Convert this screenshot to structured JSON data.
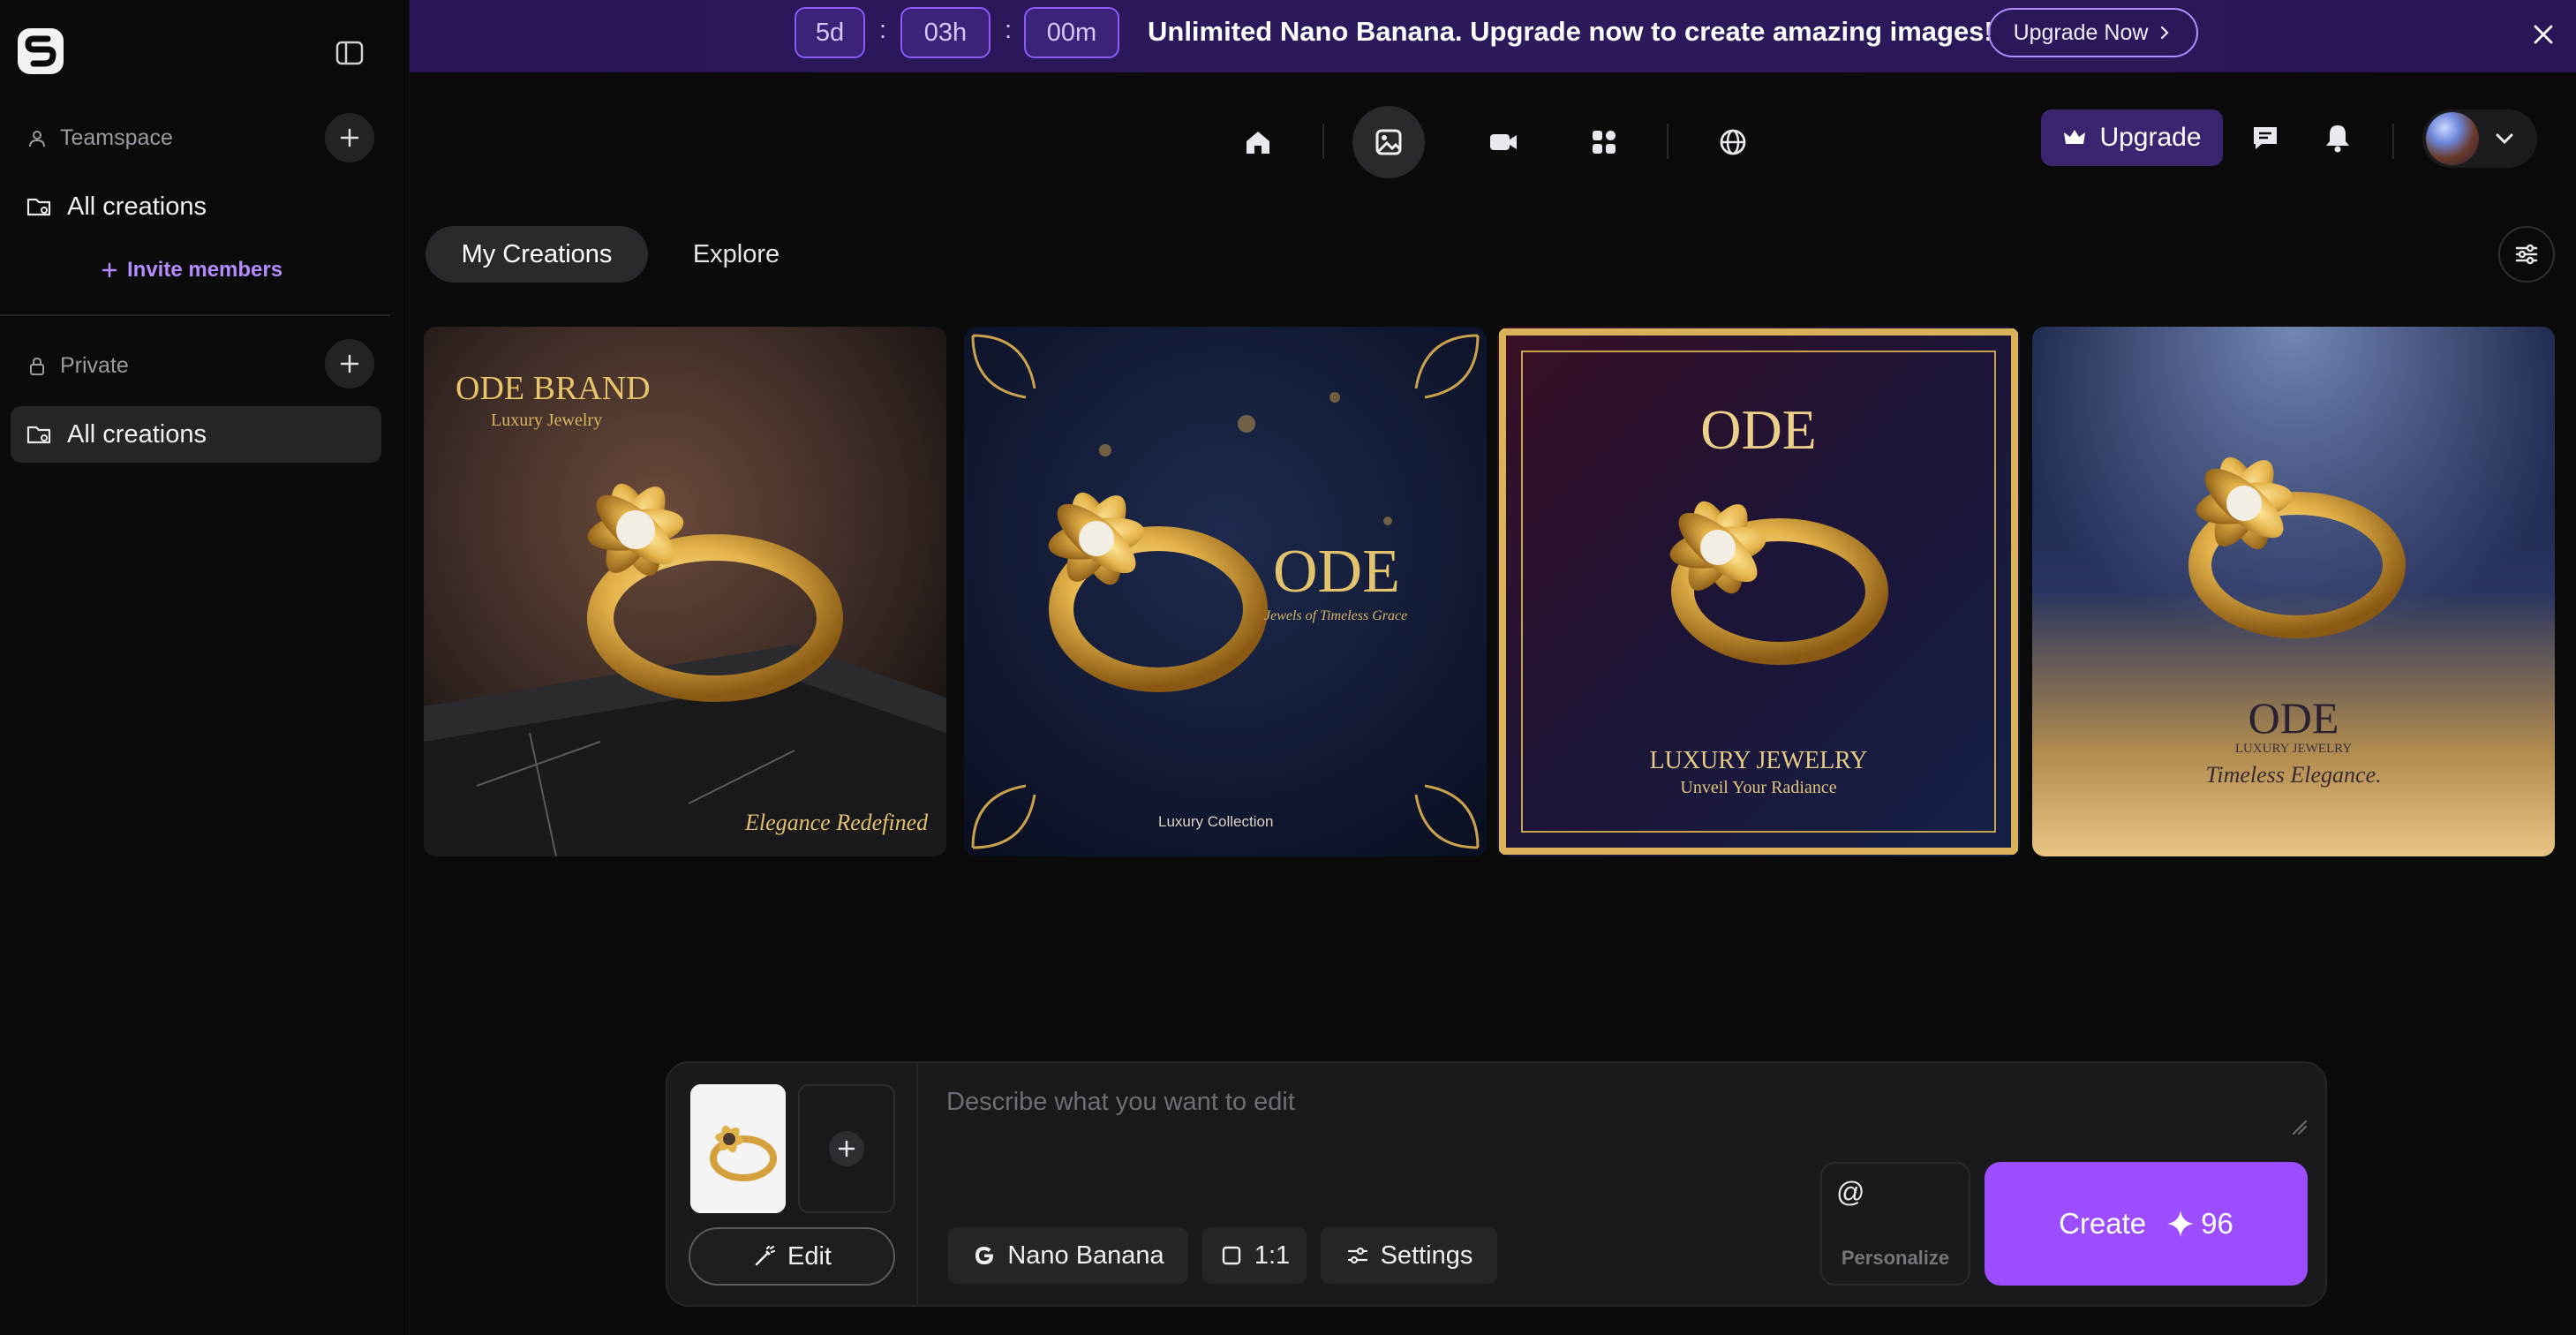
{
  "sidebar": {
    "teamspace_label": "Teamspace",
    "team_all_creations": "All creations",
    "invite_label": "Invite members",
    "private_label": "Private",
    "private_all_creations": "All creations"
  },
  "banner": {
    "days": "5d",
    "hours": "03h",
    "minutes": "00m",
    "sep1": ":",
    "sep2": ":",
    "message": "Unlimited Nano Banana. Upgrade now to create amazing images!",
    "cta": "Upgrade Now"
  },
  "topbar": {
    "nav": [
      "home-icon",
      "image-icon",
      "video-icon",
      "apps-icon",
      "globe-icon"
    ],
    "active_nav": "image-icon",
    "upgrade_label": "Upgrade"
  },
  "tabs": [
    {
      "label": "My Creations",
      "active": true
    },
    {
      "label": "Explore",
      "active": false
    }
  ],
  "gallery": [
    {
      "brand": "ODE BRAND",
      "sub": "Luxury Jewelry",
      "tagline": "Elegance Redefined"
    },
    {
      "brand": "ODE",
      "sub": "Jewels of Timeless Grace",
      "tagline": "Luxury Collection"
    },
    {
      "brand": "ODE",
      "sub": "LUXURY JEWELRY",
      "tagline": "Unveil Your Radiance"
    },
    {
      "brand": "ODE",
      "sub": "LUXURY JEWELRY",
      "tagline": "Timeless Elegance."
    }
  ],
  "prompt": {
    "placeholder": "Describe what you want to edit",
    "edit_label": "Edit",
    "model_label": "Nano Banana",
    "ratio_label": "1:1",
    "settings_label": "Settings",
    "personalize_symbol": "@",
    "personalize_label": "Personalize",
    "create_label": "Create",
    "credits": "96"
  },
  "colors": {
    "accent": "#9b4dff",
    "banner": "#2a1658",
    "background": "#0b0b0c"
  }
}
